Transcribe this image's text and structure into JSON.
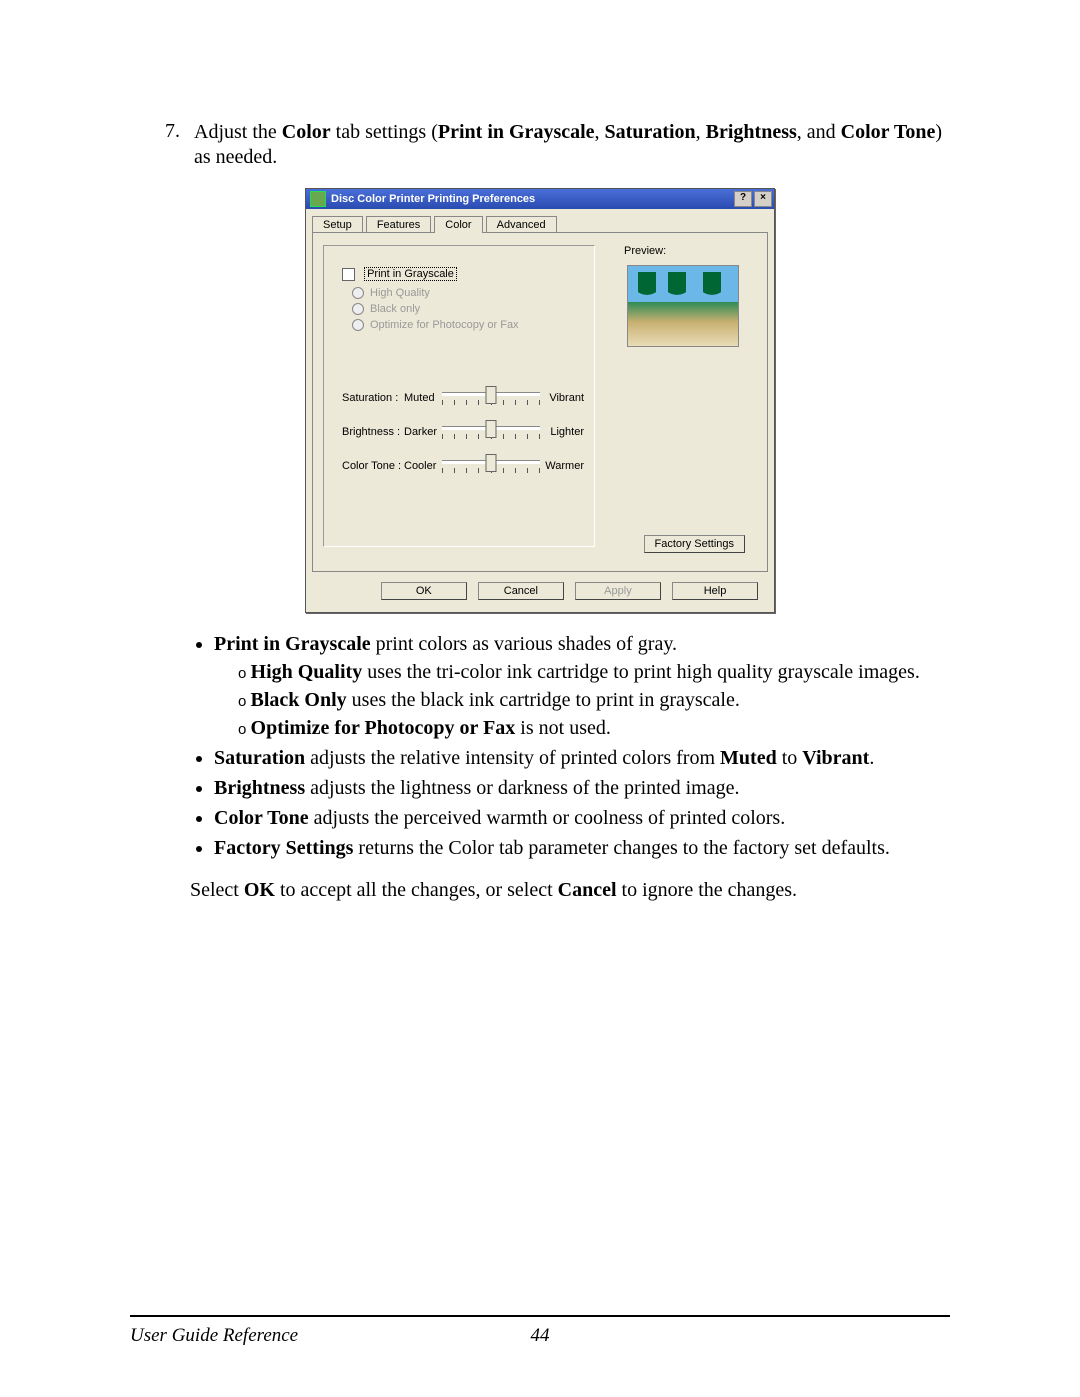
{
  "step": {
    "number": "7.",
    "pre": "Adjust the ",
    "b1": "Color",
    "mid1": " tab settings (",
    "b2": "Print in Grayscale",
    "sep1": ", ",
    "b3": "Saturation",
    "sep2": ", ",
    "b4": "Brightness",
    "mid2": ", and ",
    "b5": "Color Tone",
    "post": ") as needed."
  },
  "dialog": {
    "title": "Disc Color Printer Printing Preferences",
    "help_btn": "?",
    "close_btn": "×",
    "tabs": [
      "Setup",
      "Features",
      "Color",
      "Advanced"
    ],
    "active_tab": "Color",
    "grayscale_checkbox_label": "Print in Grayscale",
    "radios": [
      "High Quality",
      "Black only",
      "Optimize for Photocopy or Fax"
    ],
    "sliders": [
      {
        "label": "Saturation :",
        "min": "Muted",
        "max": "Vibrant"
      },
      {
        "label": "Brightness :",
        "min": "Darker",
        "max": "Lighter"
      },
      {
        "label": "Color Tone :",
        "min": "Cooler",
        "max": "Warmer"
      }
    ],
    "preview_label": "Preview:",
    "factory_btn": "Factory Settings",
    "buttons": {
      "ok": "OK",
      "cancel": "Cancel",
      "apply": "Apply",
      "help": "Help"
    }
  },
  "bullets": {
    "grayscale": {
      "bold": "Print in Grayscale",
      "rest": " print colors as various shades of gray."
    },
    "hq": {
      "bold": "High Quality",
      "rest": " uses the tri-color ink cartridge to print high quality grayscale images."
    },
    "bo": {
      "bold": "Black Only",
      "rest": " uses the black ink cartridge to print in grayscale."
    },
    "opt": {
      "bold": "Optimize for Photocopy or Fax",
      "rest": " is not used."
    },
    "sat": {
      "bold": "Saturation",
      "rest1": " adjusts the relative intensity of printed colors from ",
      "b2": "Muted",
      "rest2": " to ",
      "b3": "Vibrant",
      "rest3": "."
    },
    "bri": {
      "bold": "Brightness",
      "rest": " adjusts the lightness or darkness of the printed image."
    },
    "ct": {
      "bold": "Color Tone",
      "rest": " adjusts the perceived warmth or coolness of printed colors."
    },
    "fs": {
      "bold": "Factory Settings",
      "rest": " returns the Color tab parameter changes to the factory set defaults."
    }
  },
  "final": {
    "pre": "Select ",
    "b1": "OK",
    "mid": " to accept all the changes, or select ",
    "b2": "Cancel",
    "post": " to ignore the changes."
  },
  "footer": {
    "left": "User Guide Reference",
    "page": "44"
  }
}
